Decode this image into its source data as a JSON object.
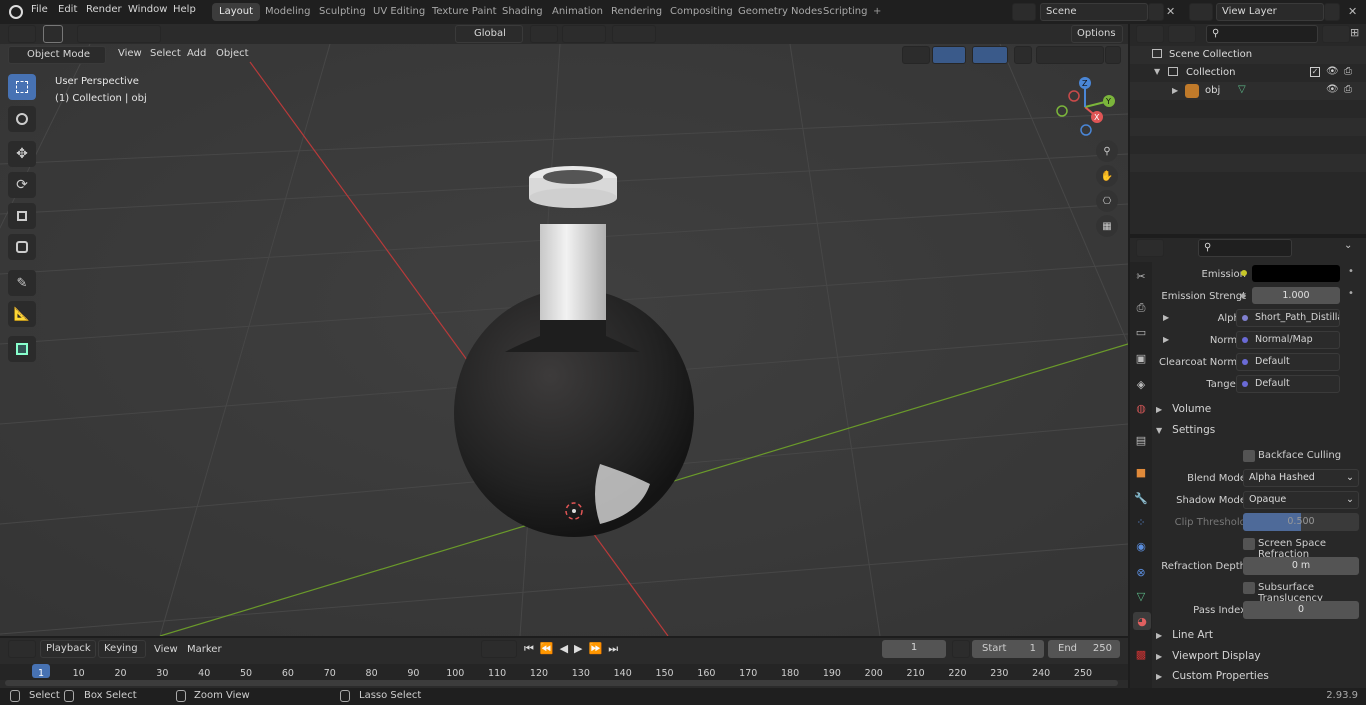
{
  "menu": {
    "file": "File",
    "edit": "Edit",
    "render": "Render",
    "window": "Window",
    "help": "Help"
  },
  "workspaces": [
    "Layout",
    "Modeling",
    "Sculpting",
    "UV Editing",
    "Texture Paint",
    "Shading",
    "Animation",
    "Rendering",
    "Compositing",
    "Geometry Nodes",
    "Scripting"
  ],
  "scene": "Scene",
  "view_layer": "View Layer",
  "tool_header": {
    "orientation": "Global",
    "options": "Options"
  },
  "view3d_header": {
    "mode": "Object Mode",
    "view": "View",
    "select": "Select",
    "add": "Add",
    "object": "Object"
  },
  "overlay": {
    "perspective": "User Perspective",
    "collection": "(1) Collection | obj"
  },
  "gizmo": {
    "x": "X",
    "y": "Y",
    "z": "Z"
  },
  "outliner": {
    "scene_collection": "Scene Collection",
    "collection": "Collection",
    "obj": "obj"
  },
  "properties": {
    "emission": "Emission",
    "emission_strength_label": "Emission Strengt",
    "emission_strength": "1.000",
    "alpha": "Alpha",
    "alpha_value": "Short_Path_Distillati...",
    "normal": "Normal",
    "normal_value": "Normal/Map",
    "clearcoat_normal": "Clearcoat Normal",
    "clearcoat_value": "Default",
    "tangent": "Tangent",
    "tangent_value": "Default",
    "volume": "Volume",
    "settings": "Settings",
    "backface_culling": "Backface Culling",
    "blend_mode_label": "Blend Mode",
    "blend_mode": "Alpha Hashed",
    "shadow_mode_label": "Shadow Mode",
    "shadow_mode": "Opaque",
    "clip_threshold_label": "Clip Threshold",
    "clip_threshold": "0.500",
    "ssr": "Screen Space Refraction",
    "refraction_depth_label": "Refraction Depth",
    "refraction_depth": "0 m",
    "subsurface": "Subsurface Translucency",
    "pass_index_label": "Pass Index",
    "pass_index": "0",
    "line_art": "Line Art",
    "viewport_display": "Viewport Display",
    "custom_properties": "Custom Properties"
  },
  "timeline": {
    "playback": "Playback",
    "keying": "Keying",
    "view": "View",
    "marker": "Marker",
    "current_frame": "1",
    "start_label": "Start",
    "start": "1",
    "end_label": "End",
    "end": "250",
    "ticks": [
      "1",
      "10",
      "20",
      "30",
      "40",
      "50",
      "60",
      "70",
      "80",
      "90",
      "100",
      "110",
      "120",
      "130",
      "140",
      "150",
      "160",
      "170",
      "180",
      "190",
      "200",
      "210",
      "220",
      "230",
      "240",
      "250"
    ]
  },
  "status": {
    "select": "Select",
    "box_select": "Box Select",
    "zoom_view": "Zoom View",
    "lasso_select": "Lasso Select",
    "version": "2.93.9"
  },
  "colors": {
    "accent": "#4772b3",
    "x_axis": "#b83a3a",
    "y_axis": "#6a9a2a"
  }
}
